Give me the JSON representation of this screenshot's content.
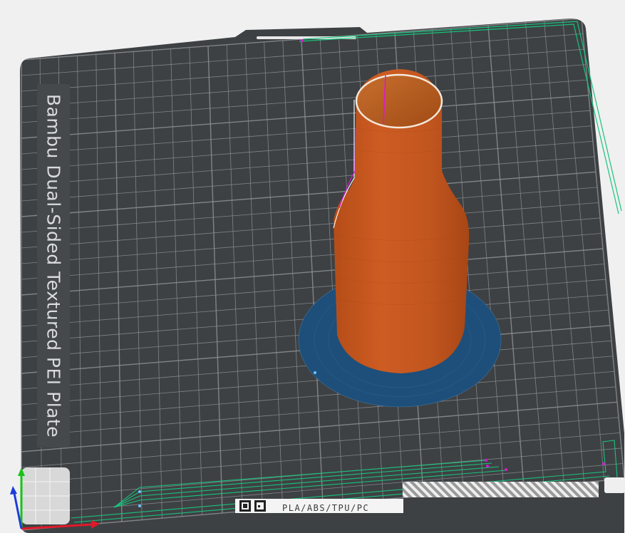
{
  "plate": {
    "brand_label": "Bambu Dual-Sided Textured PEI Plate",
    "filament_label": "PLA/ABS/TPU/PC"
  },
  "colors": {
    "background": "#f0f0f0",
    "plate": "#3e4143",
    "grid": "#8c9093",
    "model": "#c8581f",
    "brim": "#1d4f7a",
    "travel_line": "#18c27e",
    "seam": "#d81ad1",
    "axis_x": "#e0192a",
    "axis_y": "#19c219",
    "axis_z": "#1e3cdb"
  },
  "icons": {
    "qr": "qr-code-icon",
    "axes": "axis-gizmo-icon"
  }
}
